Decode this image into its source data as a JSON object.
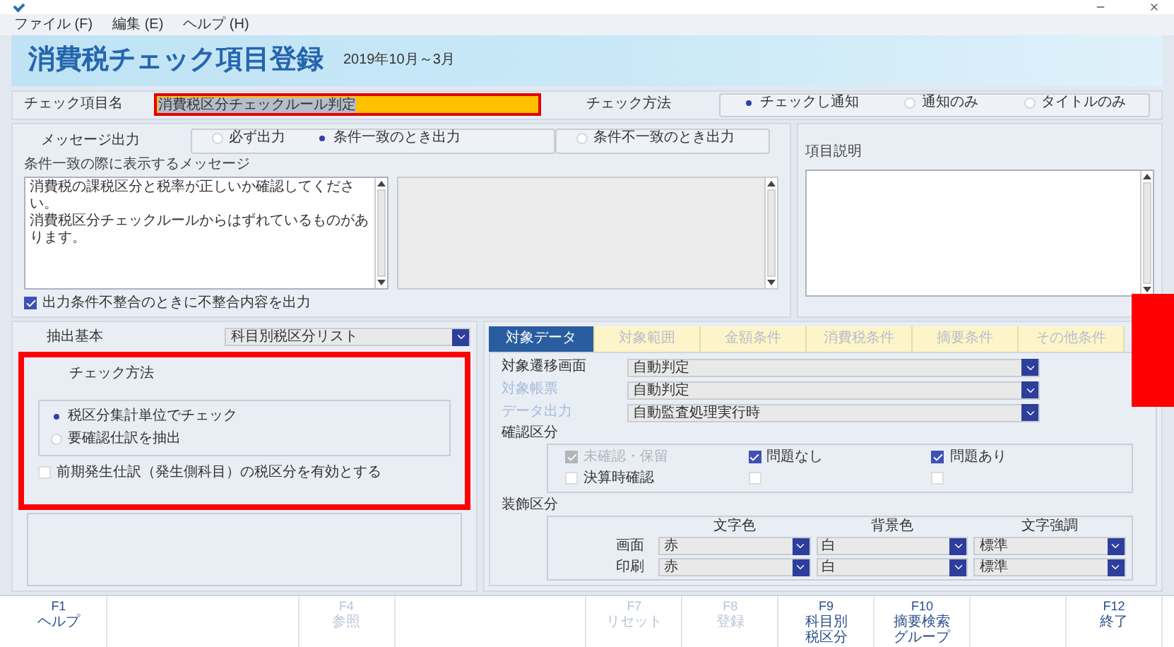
{
  "menu": [
    "ファイル (F)",
    "編集 (E)",
    "ヘルプ (H)"
  ],
  "header": {
    "title": "消費税チェック項目登録",
    "period": "2019年10月～3月"
  },
  "check_item": {
    "label": "チェック項目名",
    "value": "消費税区分チェックルール判定"
  },
  "check_method": {
    "label": "チェック方法",
    "options": [
      {
        "label": "チェックし通知",
        "selected": true
      },
      {
        "label": "通知のみ",
        "selected": false
      },
      {
        "label": "タイトルのみ",
        "selected": false
      }
    ]
  },
  "message_output": {
    "label": "メッセージ出力",
    "options": [
      {
        "label": "必ず出力",
        "selected": false
      },
      {
        "label": "条件一致のとき出力",
        "selected": true
      },
      {
        "label": "条件不一致のとき出力",
        "selected": false
      }
    ]
  },
  "message": {
    "label": "条件一致の際に表示するメッセージ",
    "lines": [
      "消費税の課税区分と税率が正しいか確認してください。",
      "消費税区分チェックルールからはずれているものがあります。"
    ]
  },
  "mismatch_output": {
    "label": "出力条件不整合のときに不整合内容を出力",
    "checked": true
  },
  "description": {
    "label": "項目説明"
  },
  "extraction": {
    "label": "抽出基本",
    "value": "科目別税区分リスト",
    "check_method": {
      "label": "チェック方法",
      "options": [
        {
          "label": "税区分集計単位でチェック",
          "selected": true
        },
        {
          "label": "要確認仕訳を抽出",
          "selected": false
        }
      ]
    },
    "prior_period": {
      "label": "前期発生仕訳（発生側科目）の税区分を有効とする",
      "checked": false
    }
  },
  "tabs": [
    {
      "label": "対象データ",
      "selected": true,
      "disabled": false
    },
    {
      "label": "対象範囲",
      "selected": false,
      "disabled": true
    },
    {
      "label": "金額条件",
      "selected": false,
      "disabled": true
    },
    {
      "label": "消費税条件",
      "selected": false,
      "disabled": true
    },
    {
      "label": "摘要条件",
      "selected": false,
      "disabled": true
    },
    {
      "label": "その他条件",
      "selected": false,
      "disabled": true
    }
  ],
  "target": {
    "fields": [
      {
        "label": "対象遷移画面",
        "value": "自動判定",
        "disabled": false
      },
      {
        "label": "対象帳票",
        "value": "自動判定",
        "disabled": true
      },
      {
        "label": "データ出力",
        "value": "自動監査処理実行時",
        "disabled": true
      }
    ],
    "confirm": {
      "label": "確認区分",
      "options": [
        {
          "label": "未確認・保留",
          "checked": true,
          "disabled": true
        },
        {
          "label": "問題なし",
          "checked": true
        },
        {
          "label": "問題あり",
          "checked": true
        },
        {
          "label": "決算時確認",
          "checked": false
        },
        {
          "checked": false
        },
        {
          "checked": false
        }
      ]
    },
    "decoration": {
      "label": "装飾区分",
      "columns": [
        "文字色",
        "背景色",
        "文字強調"
      ],
      "rows": [
        {
          "label": "画面",
          "values": [
            "赤",
            "白",
            "標準"
          ]
        },
        {
          "label": "印刷",
          "values": [
            "赤",
            "白",
            "標準"
          ]
        }
      ]
    }
  },
  "function_keys": [
    {
      "kind": "key",
      "key": "F1",
      "lines": [
        "ヘルプ"
      ],
      "disabled": false
    },
    {
      "kind": "blank"
    },
    {
      "kind": "blank"
    },
    {
      "kind": "key",
      "key": "F4",
      "lines": [
        "参照"
      ],
      "disabled": true
    },
    {
      "kind": "blank"
    },
    {
      "kind": "blank"
    },
    {
      "kind": "key",
      "key": "F7",
      "lines": [
        "リセット"
      ],
      "disabled": true
    },
    {
      "kind": "key",
      "key": "F8",
      "lines": [
        "登録"
      ],
      "disabled": true
    },
    {
      "kind": "key",
      "key": "F9",
      "lines": [
        "科目別",
        "税区分"
      ],
      "disabled": false
    },
    {
      "kind": "key",
      "key": "F10",
      "lines": [
        "摘要検索",
        "グループ"
      ],
      "disabled": false
    },
    {
      "kind": "blank"
    },
    {
      "kind": "key",
      "key": "F12",
      "lines": [
        "終了"
      ],
      "disabled": false
    }
  ]
}
